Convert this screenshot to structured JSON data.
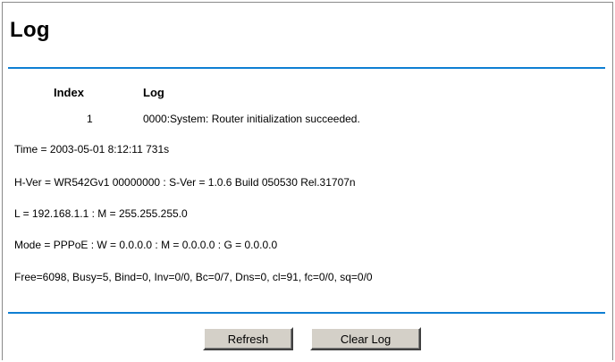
{
  "page": {
    "title": "Log"
  },
  "log_table": {
    "columns": [
      "Index",
      "Log"
    ],
    "rows": [
      {
        "index": "1",
        "message": "0000:System: Router initialization succeeded."
      }
    ]
  },
  "info": {
    "time": "Time = 2003-05-01 8:12:11 731s",
    "version": "H-Ver = WR542Gv1 00000000 : S-Ver = 1.0.6 Build 050530 Rel.31707n",
    "lan": "L = 192.168.1.1 : M = 255.255.255.0",
    "mode": "Mode = PPPoE : W = 0.0.0.0 : M = 0.0.0.0 : G = 0.0.0.0",
    "stats": "Free=6098, Busy=5, Bind=0, Inv=0/0, Bc=0/7, Dns=0, cl=91, fc=0/0, sq=0/0"
  },
  "buttons": {
    "refresh": "Refresh",
    "clear_log": "Clear Log"
  },
  "colors": {
    "rule": "#0f7fd3",
    "button_face": "#d4d0c8"
  }
}
